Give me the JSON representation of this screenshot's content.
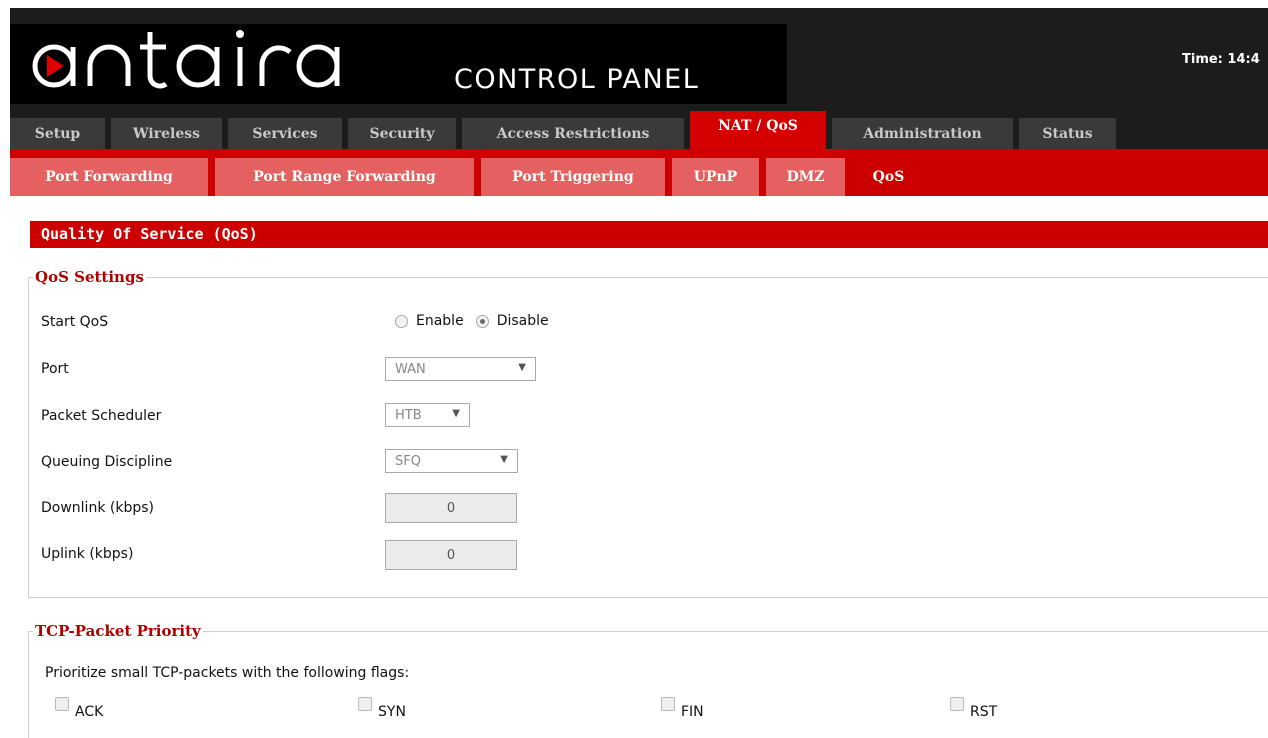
{
  "header": {
    "logo_text": "antaira",
    "control_panel": "CONTROL PANEL",
    "clock_label": "Time: 14:4"
  },
  "main_tabs": [
    {
      "label": "Setup",
      "active": false
    },
    {
      "label": "Wireless",
      "active": false
    },
    {
      "label": "Services",
      "active": false
    },
    {
      "label": "Security",
      "active": false
    },
    {
      "label": "Access Restrictions",
      "active": false
    },
    {
      "label": "NAT / QoS",
      "active": true
    },
    {
      "label": "Administration",
      "active": false
    },
    {
      "label": "Status",
      "active": false
    }
  ],
  "sub_tabs": [
    {
      "label": "Port Forwarding",
      "active": false
    },
    {
      "label": "Port Range Forwarding",
      "active": false
    },
    {
      "label": "Port Triggering",
      "active": false
    },
    {
      "label": "UPnP",
      "active": false
    },
    {
      "label": "DMZ",
      "active": false
    },
    {
      "label": "QoS",
      "active": true
    }
  ],
  "page_title": "Quality Of Service (QoS)",
  "qos_settings": {
    "legend": "QoS Settings",
    "start_qos": {
      "label": "Start QoS",
      "enable_label": "Enable",
      "disable_label": "Disable",
      "selected": "Disable"
    },
    "port": {
      "label": "Port",
      "value": "WAN"
    },
    "packet_scheduler": {
      "label": "Packet Scheduler",
      "value": "HTB"
    },
    "queuing_discipline": {
      "label": "Queuing Discipline",
      "value": "SFQ"
    },
    "downlink": {
      "label": "Downlink (kbps)",
      "value": "0"
    },
    "uplink": {
      "label": "Uplink (kbps)",
      "value": "0"
    }
  },
  "tcp_priority": {
    "legend": "TCP-Packet Priority",
    "instruction": "Prioritize small TCP-packets with the following flags:",
    "flags": [
      "ACK",
      "SYN",
      "FIN",
      "RST"
    ]
  },
  "colors": {
    "brand_red": "#cc0000",
    "header_dark": "#1c1c1c",
    "tab_inactive": "#3a3a3a",
    "subtab_inactive": "#e56060",
    "legend_red": "#b00000"
  },
  "icons": {
    "logo_mark": "play-icon",
    "select_arrow": "chevron-down-icon"
  }
}
